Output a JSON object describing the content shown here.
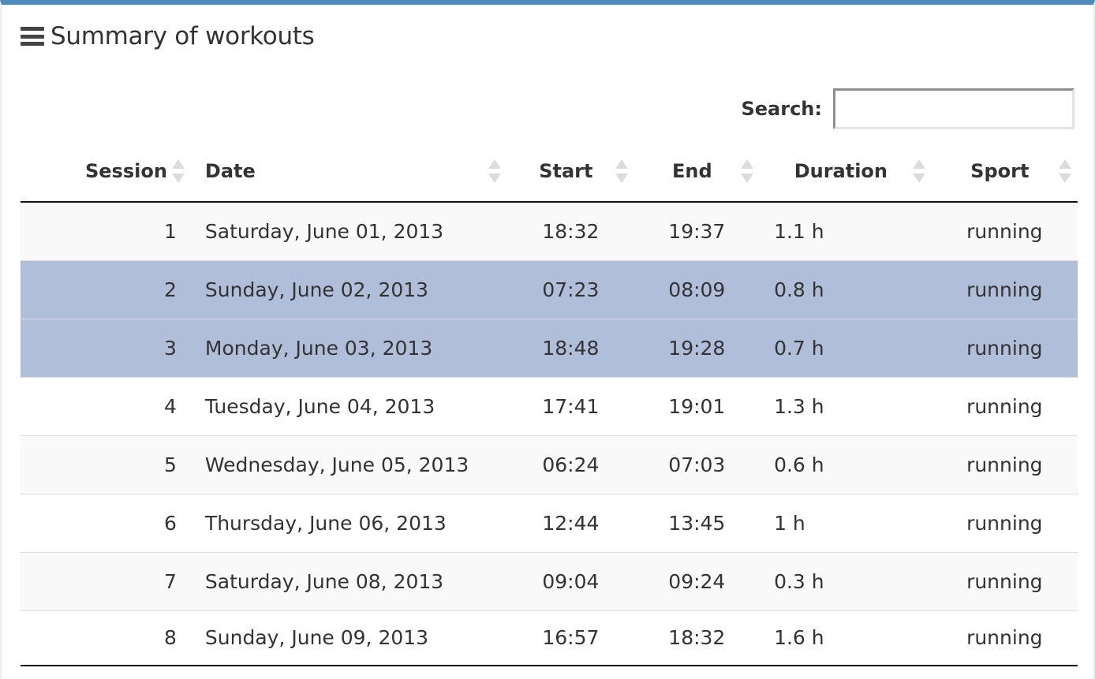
{
  "panel": {
    "title": "Summary of workouts",
    "menu_icon": "hamburger-icon",
    "accent_color": "#4f8bbd"
  },
  "search": {
    "label": "Search:",
    "value": "",
    "placeholder": ""
  },
  "table": {
    "columns": [
      "Session",
      "Date",
      "Start",
      "End",
      "Duration",
      "Sport"
    ],
    "sort_icon": "sort-both-icon",
    "selected_row_color": "#b0bed9",
    "rows": [
      {
        "session": "1",
        "date": "Saturday, June 01, 2013",
        "start": "18:32",
        "end": "19:37",
        "duration": "1.1 h",
        "sport": "running",
        "selected": false
      },
      {
        "session": "2",
        "date": "Sunday, June 02, 2013",
        "start": "07:23",
        "end": "08:09",
        "duration": "0.8 h",
        "sport": "running",
        "selected": true
      },
      {
        "session": "3",
        "date": "Monday, June 03, 2013",
        "start": "18:48",
        "end": "19:28",
        "duration": "0.7 h",
        "sport": "running",
        "selected": true
      },
      {
        "session": "4",
        "date": "Tuesday, June 04, 2013",
        "start": "17:41",
        "end": "19:01",
        "duration": "1.3 h",
        "sport": "running",
        "selected": false
      },
      {
        "session": "5",
        "date": "Wednesday, June 05, 2013",
        "start": "06:24",
        "end": "07:03",
        "duration": "0.6 h",
        "sport": "running",
        "selected": false
      },
      {
        "session": "6",
        "date": "Thursday, June 06, 2013",
        "start": "12:44",
        "end": "13:45",
        "duration": "1 h",
        "sport": "running",
        "selected": false
      },
      {
        "session": "7",
        "date": "Saturday, June 08, 2013",
        "start": "09:04",
        "end": "09:24",
        "duration": "0.3 h",
        "sport": "running",
        "selected": false
      },
      {
        "session": "8",
        "date": "Sunday, June 09, 2013",
        "start": "16:57",
        "end": "18:32",
        "duration": "1.6 h",
        "sport": "running",
        "selected": false
      }
    ]
  }
}
